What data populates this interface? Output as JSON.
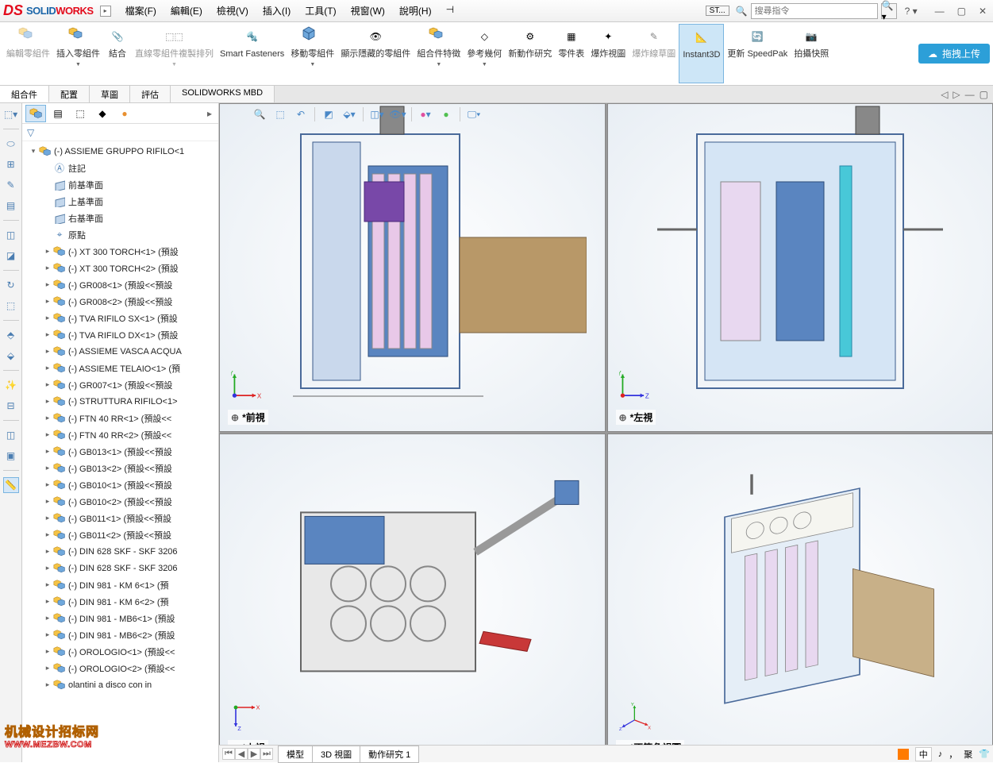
{
  "app": {
    "name_solid": "SOLID",
    "name_works": "WORKS"
  },
  "menu": [
    "檔案(F)",
    "編輯(E)",
    "檢視(V)",
    "插入(I)",
    "工具(T)",
    "視窗(W)",
    "說明(H)"
  ],
  "search": {
    "placeholder": "搜尋指令",
    "st": "ST..."
  },
  "ribbon": {
    "edit_comp": "編輯零組件",
    "insert_comp": "插入零組件",
    "mate": "結合",
    "linear_pattern": "直線零組件複製排列",
    "smart": "Smart Fasteners",
    "move": "移動零組件",
    "show_hidden": "顯示隱藏的零組件",
    "asm_feat": "組合件特徵",
    "ref_geom": "參考幾何",
    "motion": "新動作研究",
    "bom": "零件表",
    "explode": "爆炸視圖",
    "explode_sketch": "爆炸線草圖",
    "instant3d": "Instant3D",
    "speedpak": "更新 SpeedPak",
    "snapshot": "拍攝快照",
    "upload": "拖拽上传"
  },
  "doc_tabs": [
    "組合件",
    "配置",
    "草圖",
    "評估",
    "SOLIDWORKS MBD"
  ],
  "tree": {
    "root": "(-) ASSIEME GRUPPO RIFILO<1",
    "annotations": "註記",
    "planes": [
      "前基準面",
      "上基準面",
      "右基準面"
    ],
    "origin": "原點",
    "items": [
      "(-) XT 300 TORCH<1> (預設",
      "(-) XT 300 TORCH<2> (預設",
      "(-) GR008<1> (預設<<預設",
      "(-) GR008<2> (預設<<預設",
      "(-) TVA RIFILO SX<1> (預設",
      "(-) TVA RIFILO DX<1> (預設",
      "(-) ASSIEME VASCA ACQUA",
      "(-) ASSIEME TELAIO<1> (預",
      "(-) GR007<1> (預設<<預設",
      "(-) STRUTTURA RIFILO<1>",
      "(-) FTN 40 RR<1> (預設<<",
      "(-) FTN 40 RR<2> (預設<<",
      "(-) GB013<1> (預設<<預設",
      "(-) GB013<2> (預設<<預設",
      "(-) GB010<1> (預設<<預設",
      "(-) GB010<2> (預設<<預設",
      "(-) GB011<1> (預設<<預設",
      "(-) GB011<2> (預設<<預設",
      "(-) DIN 628 SKF - SKF 3206",
      "(-) DIN 628 SKF - SKF 3206",
      "(-) DIN 981 - KM 6<1> (預",
      "(-) DIN 981 - KM 6<2> (預",
      "(-) DIN 981 - MB6<1> (預設",
      "(-) DIN 981 - MB6<2> (預設",
      "(-) OROLOGIO<1> (預設<<",
      "(-) OROLOGIO<2> (預設<<",
      "olantini a disco con in"
    ]
  },
  "views": {
    "front": "*前視",
    "left": "*左視",
    "top": "*上視",
    "iso": "*不等角視圖"
  },
  "bottom_tabs": [
    "模型",
    "3D 視圖",
    "動作研究 1"
  ],
  "status": {
    "lang": "中",
    "ime": "聚"
  },
  "watermark": {
    "line1": "机械设计招标网",
    "line2": "WWW.MEZBW.COM"
  }
}
